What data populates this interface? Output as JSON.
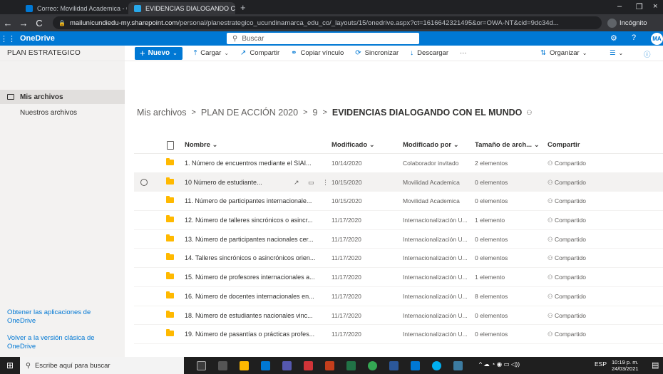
{
  "browser": {
    "tabs": [
      {
        "label": "Correo: Movilidad Academica - C",
        "close": "×"
      },
      {
        "label": "EVIDENCIAS DIALOGANDO CON",
        "close": "×"
      }
    ],
    "new_tab": "+",
    "window_controls": {
      "minimize": "–",
      "maximize": "❐",
      "close": "×"
    },
    "nav": {
      "back": "←",
      "forward": "→",
      "reload": "C"
    },
    "url_host": "mailunicundiedu-my.sharepoint.com",
    "url_path": "/personal/planestrategico_ucundinamarca_edu_co/_layouts/15/onedrive.aspx?ct=1616642321495&or=OWA-NT&cid=9dc34d...",
    "incognito_label": "Incógnito"
  },
  "suite": {
    "app_name": "OneDrive",
    "search_placeholder": "Buscar",
    "avatar_initials": "MA"
  },
  "sidebar": {
    "site_title": "PLAN ESTRATEGICO",
    "items": [
      {
        "label": "Mis archivos"
      },
      {
        "label": "Nuestros archivos"
      }
    ],
    "get_apps": "Obtener las aplicaciones de OneDrive",
    "classic": "Volver a la versión clásica de OneDrive"
  },
  "commands": {
    "new": "Nuevo",
    "upload": "Cargar",
    "share": "Compartir",
    "copy_link": "Copiar vínculo",
    "sync": "Sincronizar",
    "download": "Descargar",
    "more": "···",
    "organize": "Organizar"
  },
  "breadcrumb": {
    "items": [
      "Mis archivos",
      "PLAN DE ACCIÓN 2020",
      "9"
    ],
    "current": "EVIDENCIAS DIALOGANDO CON EL MUNDO",
    "sep": ">"
  },
  "table": {
    "headers": {
      "name": "Nombre",
      "modified": "Modificado",
      "modified_by": "Modificado por",
      "size": "Tamaño de arch...",
      "share": "Compartir"
    },
    "rows": [
      {
        "name": "1. Número de encuentros mediante el SIAI...",
        "modified": "10/14/2020",
        "by": "Colaborador invitado",
        "size": "2 elementos",
        "share": "Compartido"
      },
      {
        "name": "10 Número de estudiante...",
        "modified": "10/15/2020",
        "by": "Movilidad Academica",
        "size": "0 elementos",
        "share": "Compartido"
      },
      {
        "name": "11. Número de participantes internacionale...",
        "modified": "10/15/2020",
        "by": "Movilidad Academica",
        "size": "0 elementos",
        "share": "Compartido"
      },
      {
        "name": "12. Número de talleres sincrónicos o asincr...",
        "modified": "11/17/2020",
        "by": "Internacionalización U...",
        "size": "1 elemento",
        "share": "Compartido"
      },
      {
        "name": "13. Número de participantes nacionales cer...",
        "modified": "11/17/2020",
        "by": "Internacionalización U...",
        "size": "0 elementos",
        "share": "Compartido"
      },
      {
        "name": "14. Talleres sincrónicos o asincrónicos orien...",
        "modified": "11/17/2020",
        "by": "Internacionalización U...",
        "size": "0 elementos",
        "share": "Compartido"
      },
      {
        "name": "15. Número de profesores internacionales a...",
        "modified": "11/17/2020",
        "by": "Internacionalización U...",
        "size": "1 elemento",
        "share": "Compartido"
      },
      {
        "name": "16. Número de docentes internacionales en...",
        "modified": "11/17/2020",
        "by": "Internacionalización U...",
        "size": "8 elementos",
        "share": "Compartido"
      },
      {
        "name": "18. Número de estudiantes nacionales vinc...",
        "modified": "11/17/2020",
        "by": "Internacionalización U...",
        "size": "0 elementos",
        "share": "Compartido"
      },
      {
        "name": "19. Número de pasantías o prácticas profes...",
        "modified": "11/17/2020",
        "by": "Internacionalización U...",
        "size": "0 elementos",
        "share": "Compartido"
      }
    ]
  },
  "taskbar": {
    "search_placeholder": "Escribe aquí para buscar",
    "lang": "ESP",
    "time": "10:19 p. m.",
    "date": "24/03/2021"
  },
  "colors": {
    "accent": "#0078d4",
    "folder": "#ffb900"
  }
}
